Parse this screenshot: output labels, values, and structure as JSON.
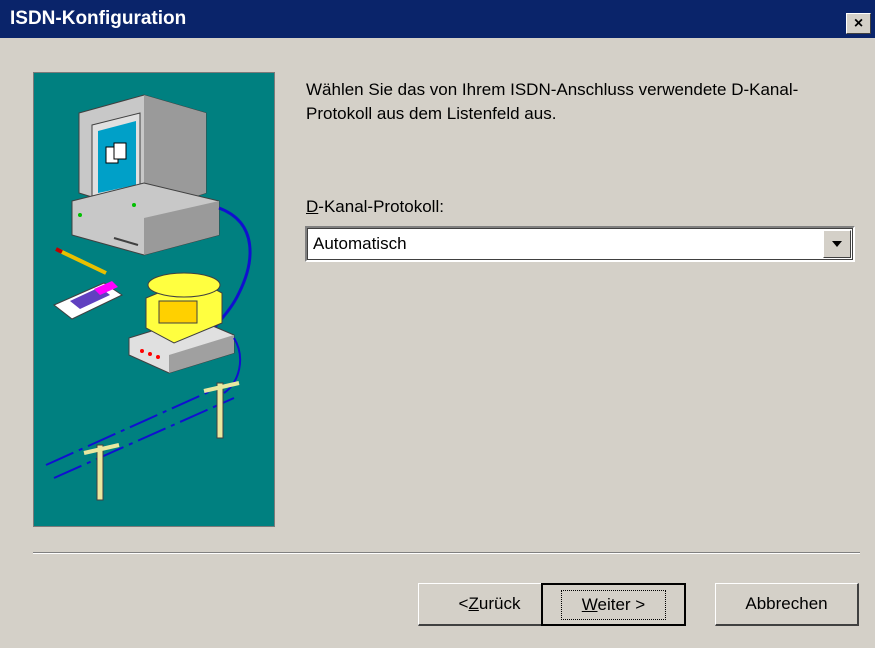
{
  "window": {
    "title": "ISDN-Konfiguration",
    "close_label": "×"
  },
  "main": {
    "instruction": "Wählen Sie das von Ihrem ISDN-Anschluss verwendete D-Kanal-Protokoll aus dem Listenfeld aus.",
    "field_label_mnemonic": "D",
    "field_label_rest": "-Kanal-Protokoll:",
    "protocol_value": "Automatisch"
  },
  "buttons": {
    "back_prefix": "< ",
    "back_mnemonic": "Z",
    "back_rest": "urück",
    "next_mnemonic": "W",
    "next_rest": "eiter >",
    "cancel": "Abbrechen"
  },
  "colors": {
    "titlebar": "#0a246a",
    "dialog_bg": "#d4d0c8",
    "illustration_bg": "#008080"
  },
  "icons": {
    "illustration": "computer-phone-wire-illustration",
    "dropdown": "chevron-down-icon"
  }
}
